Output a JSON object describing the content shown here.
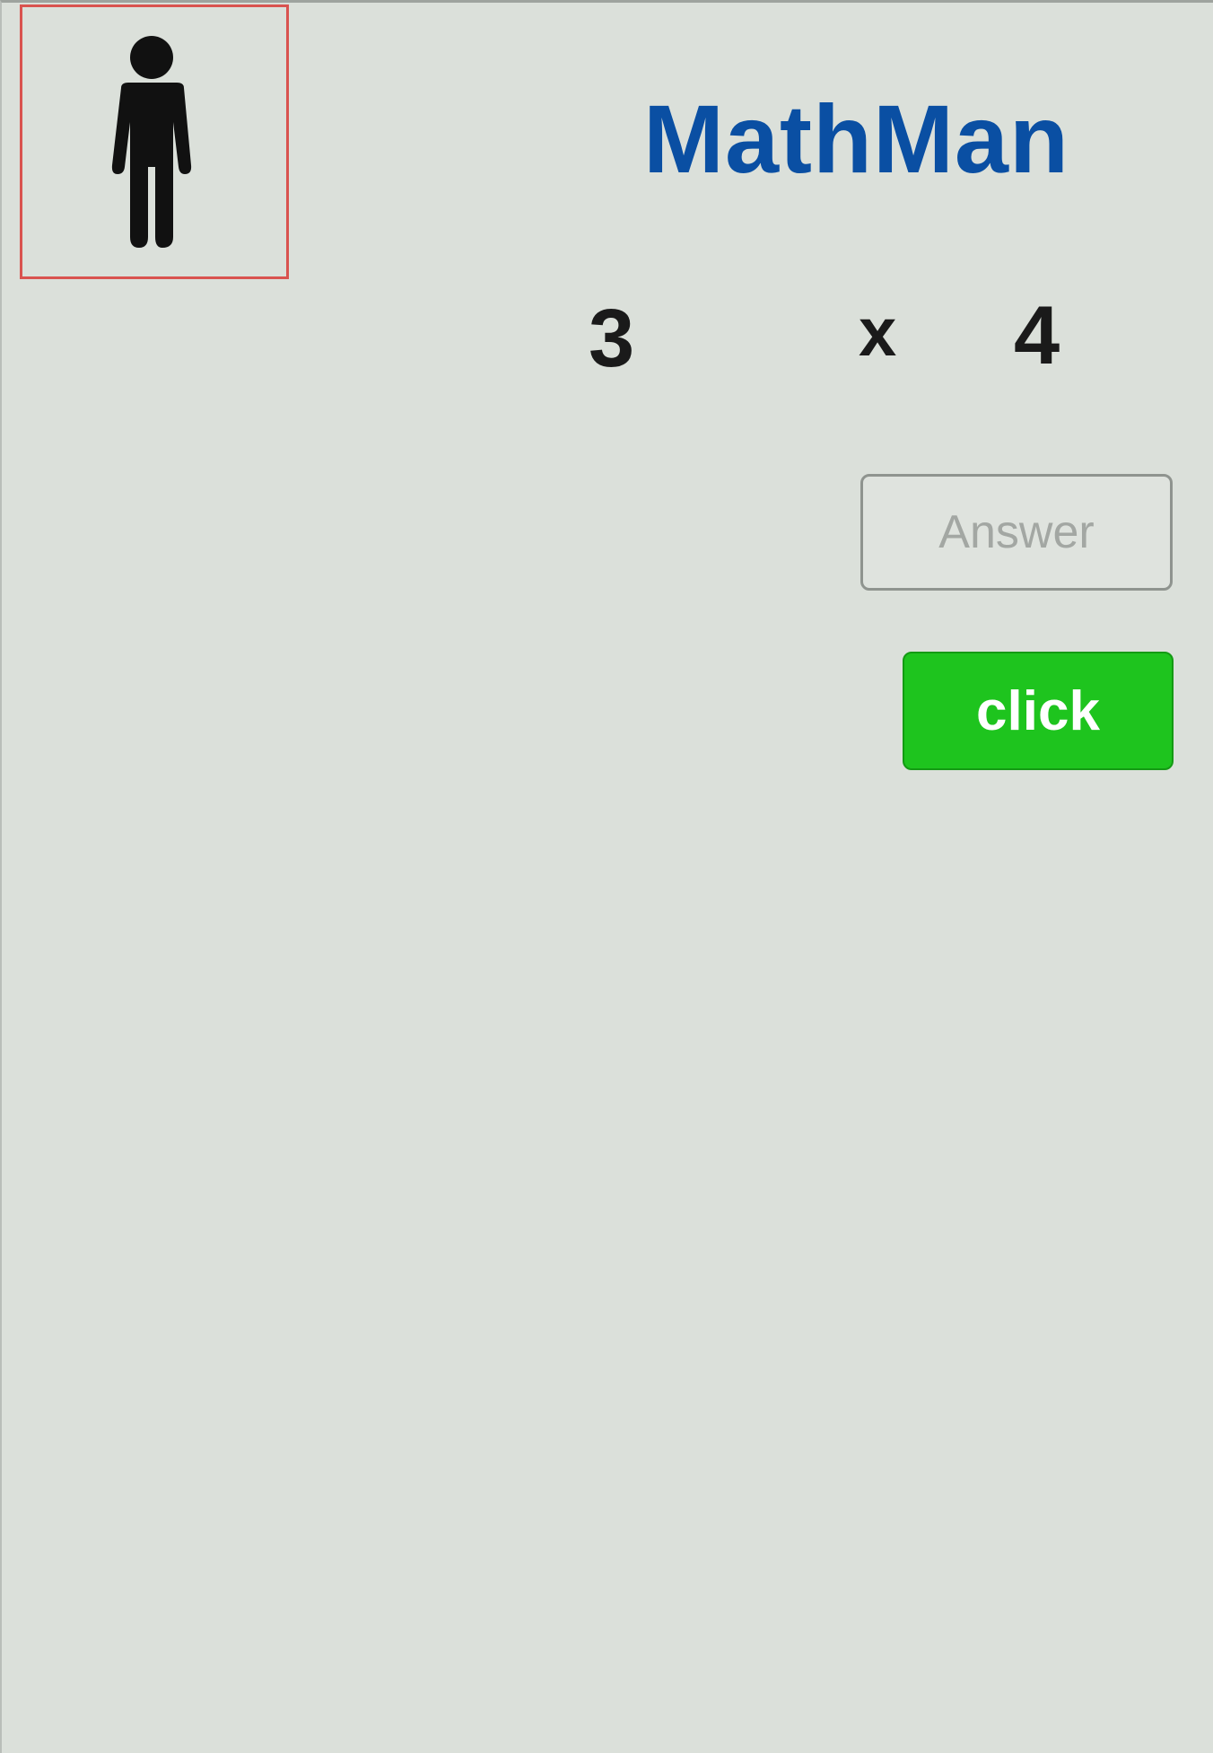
{
  "header": {
    "title": "MathMan",
    "avatar_icon": "person-icon",
    "avatar_border_color": "#d9534f",
    "title_color": "#0a4fa3"
  },
  "problem": {
    "operand_a": "3",
    "operator": "x",
    "operand_b": "4"
  },
  "answer": {
    "placeholder": "Answer",
    "value": ""
  },
  "submit": {
    "label": "click",
    "color": "#1ec41e"
  }
}
